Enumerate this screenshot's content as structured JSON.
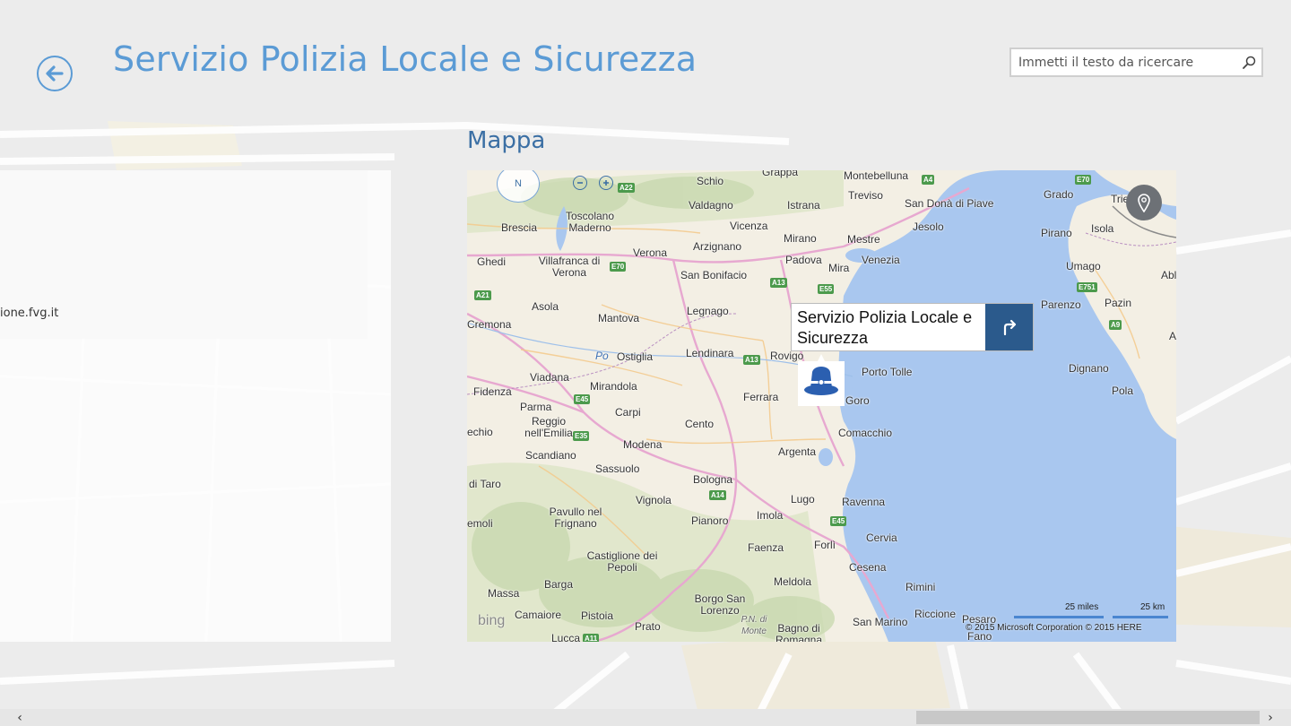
{
  "header": {
    "title": "Servizio Polizia Locale e Sicurezza",
    "search_placeholder": "Immetti il testo da ricercare"
  },
  "left_panel": {
    "website_fragment": "ione.fvg.it"
  },
  "map_section": {
    "heading": "Mappa",
    "compass_label": "N",
    "callout_title": "Servizio Polizia Locale e Sicurezza",
    "scale_miles": "25 miles",
    "scale_km": "25 km",
    "copyright": "© 2015 Microsoft Corporation    © 2015 HERE",
    "logo_text": "bing",
    "places": [
      "Schio",
      "Grappa",
      "Montebelluna",
      "Treviso",
      "San Donà di Piave",
      "Grado",
      "Trie",
      "Valdagno",
      "Istrana",
      "Jesolo",
      "Brescia",
      "Toscolano Maderno",
      "Vicenza",
      "Mirano",
      "Mestre",
      "Pirano",
      "Isola",
      "Verona",
      "Arzignano",
      "Padova",
      "Venezia",
      "Umago",
      "Ghedi",
      "Villafranca di Verona",
      "San Bonifacio",
      "Mira",
      "Abl",
      "Asola",
      "Legnago",
      "Parenzo",
      "Pazin",
      "Cremona",
      "Mantova",
      "Lendinara",
      "Rovigo",
      "Porto Tolle",
      "Ostiglia",
      "Dignano",
      "Viadana",
      "Po",
      "Pola",
      "Fidenza",
      "Mirandola",
      "Ferrara",
      "Goro",
      "Parma",
      "Carpi",
      "Cento",
      "Reggio nell'Emilia",
      "Comacchio",
      "echio",
      "Modena",
      "Argenta",
      "Scandiano",
      "Sassuolo",
      "Bologna",
      "di Taro",
      "Vignola",
      "Lugo",
      "Ravenna",
      "emoli",
      "Pavullo nel Frignano",
      "Pianoro",
      "Imola",
      "Cervia",
      "Faenza",
      "Forlì",
      "Castiglione dei Pepoli",
      "Cesena",
      "Barga",
      "Meldola",
      "Rimini",
      "Massa",
      "Borgo San Lorenzo",
      "Riccione",
      "Camaiore",
      "Pistoia",
      "P.N. di Monte",
      "Prato",
      "Bagno di Romagna",
      "San Marino",
      "Pesaro",
      "Lucca",
      "Fano",
      "A"
    ],
    "shields": [
      "A4",
      "E70",
      "A22",
      "E70",
      "A21",
      "E55",
      "A13",
      "A13",
      "E45",
      "E35",
      "A14",
      "E45",
      "A11",
      "E751",
      "A9",
      "A22"
    ]
  },
  "icons": {
    "back": "back-arrow-icon",
    "search": "search-icon",
    "locate": "location-pin-icon",
    "directions": "directions-arrow-icon",
    "pin": "police-marker-icon"
  },
  "colors": {
    "accent": "#5b9bd5",
    "heading": "#3b6fa4",
    "directions": "#2b5a8c",
    "water": "#a9c7ef"
  }
}
